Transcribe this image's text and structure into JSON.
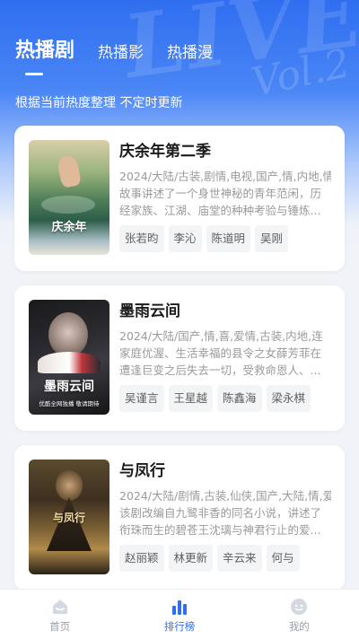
{
  "header": {
    "tabs": [
      {
        "label": "热播剧",
        "active": true
      },
      {
        "label": "热播影",
        "active": false
      },
      {
        "label": "热播漫",
        "active": false
      }
    ],
    "subtitle": "根据当前热度整理 不定时更新",
    "decor_text": [
      "LIVE",
      "Vol.2"
    ]
  },
  "cards": [
    {
      "title": "庆余年第二季",
      "tags": "2024/大陆/古装,剧情,电视,国产,情,内地,情",
      "description": "故事讲述了一个身世神秘的青年范闲，历经家族、江湖、庙堂的种种考验与锤炼...",
      "actors": [
        "张若昀",
        "李沁",
        "陈道明",
        "吴刚"
      ],
      "poster_text": "庆余年"
    },
    {
      "title": "墨雨云间",
      "tags": "2024/大陆/国产,情,喜,爱情,古装,内地,连",
      "description": "家庭优渥、生活幸福的县令之女薛芳菲在遭逢巨变之后失去一切，受救命恩人、...",
      "actors": [
        "吴谨言",
        "王星越",
        "陈鑫海",
        "梁永棋"
      ],
      "poster_text": "墨雨云间",
      "poster_caption": "优酷全网独播 敬请期待"
    },
    {
      "title": "与凤行",
      "tags": "2024/大陆/剧情,古装,仙侠,国产,大陆,情,爱",
      "description": "该剧改编自九鹭非香的同名小说，讲述了衔珠而生的碧苍王沈璃与神君行止的爱...",
      "actors": [
        "赵丽颖",
        "林更新",
        "辛云来",
        "何与"
      ],
      "poster_text": "与凤行"
    }
  ],
  "bottom_nav": [
    {
      "label": "首页",
      "icon": "home-icon",
      "active": false
    },
    {
      "label": "排行榜",
      "icon": "ranking-chart-icon",
      "active": true
    },
    {
      "label": "我的",
      "icon": "profile-face-icon",
      "active": false
    }
  ],
  "colors": {
    "accent": "#2f6ef0",
    "nav_inactive": "#9aa0a8",
    "tag_text": "#9a9a9a",
    "actor_bg": "#f3f4f6"
  }
}
